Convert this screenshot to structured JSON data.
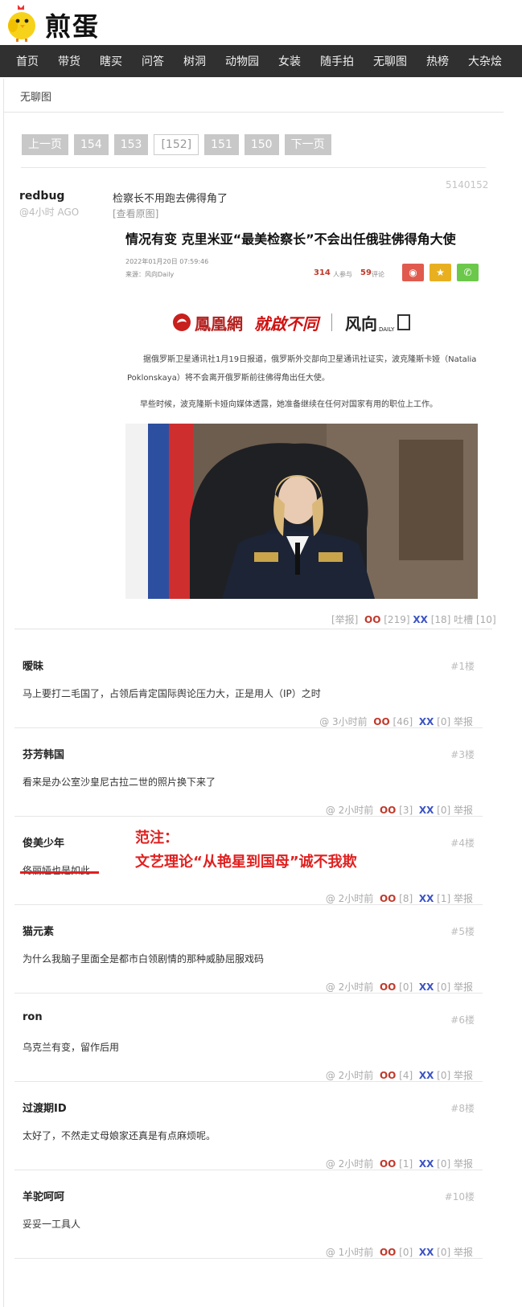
{
  "site": {
    "logo_text": "煎蛋"
  },
  "nav": [
    "首页",
    "带货",
    "瞎买",
    "问答",
    "树洞",
    "动物园",
    "女装",
    "随手拍",
    "无聊图",
    "热榜",
    "大杂烩"
  ],
  "breadcrumb": "无聊图",
  "pager": {
    "prev": "上一页",
    "pages": [
      "154",
      "153",
      "[152]",
      "151",
      "150"
    ],
    "next": "下一页",
    "current": "[152]"
  },
  "post": {
    "author": "redbug",
    "ago": "@4小时 AGO",
    "id": "5140152",
    "text": "检察长不用跑去佛得角了",
    "orig_link": "[查看原图]",
    "actions": {
      "report": "[举报]",
      "oo": "OO",
      "oo_count": "[219]",
      "xx": "XX",
      "xx_count": "[18]",
      "tucao": "吐槽 [10]"
    },
    "news": {
      "title": "情况有变 克里米亚“最美检察长”不会出任俄驻佛得角大使",
      "date": "2022年01月20日 07:59:46",
      "source": "来源：风向Daily",
      "participants": "314",
      "participants_label": "人参与",
      "comments": "59",
      "comments_label": "评论",
      "brand_ifeng": "鳳凰網",
      "brand_slogan": "就啟不同",
      "brand_fx": "风向",
      "brand_daily": "DAILY",
      "para1": "据俄罗斯卫星通讯社1月19日报道，俄罗斯外交部向卫星通讯社证实，波克隆斯卡娅（Natalia Poklonskaya）将不会离开俄罗斯前往佛得角出任大使。",
      "para2": "早些时候，波克隆斯卡娅向媒体透露，她准备继续在任何对国家有用的职位上工作。"
    }
  },
  "comments": [
    {
      "author": "暧昧",
      "floor": "#1楼",
      "text": "马上要打二毛国了，占领后肯定国际舆论压力大，正是用人（IP）之时",
      "time": "@ 3小时前",
      "oo": "OO",
      "oo_count": "[46]",
      "xx": "XX",
      "xx_count": "[0]",
      "report": "举报"
    },
    {
      "author": "芬芳韩国",
      "floor": "#3楼",
      "text": "看来是办公室沙皇尼古拉二世的照片换下来了",
      "time": "@ 2小时前",
      "oo": "OO",
      "oo_count": "[3]",
      "xx": "XX",
      "xx_count": "[0]",
      "report": "举报"
    },
    {
      "author": "俊美少年",
      "floor": "#4楼",
      "text": "佟丽娅也是如此",
      "time": "@ 2小时前",
      "oo": "OO",
      "oo_count": "[8]",
      "xx": "XX",
      "xx_count": "[1]",
      "report": "举报"
    },
    {
      "author": "猫元素",
      "floor": "#5楼",
      "text": "为什么我脑子里面全是都市白领剧情的那种威胁屈服戏码",
      "time": "@ 2小时前",
      "oo": "OO",
      "oo_count": "[0]",
      "xx": "XX",
      "xx_count": "[0]",
      "report": "举报"
    },
    {
      "author": "ron",
      "floor": "#6楼",
      "text": "乌克兰有变，留作后用",
      "time": "@ 2小时前",
      "oo": "OO",
      "oo_count": "[4]",
      "xx": "XX",
      "xx_count": "[0]",
      "report": "举报"
    },
    {
      "author": "过渡期ID",
      "floor": "#8楼",
      "text": "太好了，不然走丈母娘家还真是有点麻烦呢。",
      "time": "@ 2小时前",
      "oo": "OO",
      "oo_count": "[1]",
      "xx": "XX",
      "xx_count": "[0]",
      "report": "举报"
    },
    {
      "author": "羊驼呵呵",
      "floor": "#10楼",
      "text": "妥妥一工具人",
      "time": "@ 1小时前",
      "oo": "OO",
      "oo_count": "[0]",
      "xx": "XX",
      "xx_count": "[0]",
      "report": "举报"
    }
  ],
  "annotation": {
    "line1": "范注：",
    "line2": "文艺理论“从艳星到国母”诚不我欺"
  }
}
